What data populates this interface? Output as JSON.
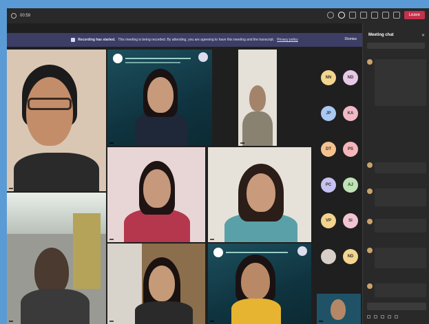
{
  "window": {
    "title": "00:59"
  },
  "toolbar": {
    "leave_label": "Leave"
  },
  "banner": {
    "heading": "Recording has started.",
    "text": "This meeting is being recorded. By attending, you are agreeing to have this meeting and the transcript.",
    "link": "Privacy policy",
    "dismiss_label": "Dismiss"
  },
  "participants": [
    {
      "name": ""
    },
    {
      "name": ""
    },
    {
      "name": ""
    },
    {
      "name": ""
    },
    {
      "name": ""
    },
    {
      "name": ""
    },
    {
      "name": ""
    },
    {
      "name": ""
    },
    {
      "name": ""
    }
  ],
  "roster": [
    {
      "initials": "NN",
      "color": "#f4d58d"
    },
    {
      "initials": "ND",
      "color": "#e7c8e6"
    },
    {
      "initials": "JP",
      "color": "#a9c8f3"
    },
    {
      "initials": "KA",
      "color": "#f1b9c7"
    },
    {
      "initials": "DT",
      "color": "#f5c28f"
    },
    {
      "initials": "PS",
      "color": "#f6b6b9"
    },
    {
      "initials": "PC",
      "color": "#c6c3f1"
    },
    {
      "initials": "AJ",
      "color": "#bfe3b5"
    },
    {
      "initials": "VP",
      "color": "#f3d38d"
    },
    {
      "initials": "SI",
      "color": "#f2c4d2"
    },
    {
      "initials": "",
      "color": "#d8d0c8"
    },
    {
      "initials": "ND",
      "color": "#f3d58f"
    }
  ],
  "chat": {
    "header": "Meeting chat",
    "search_placeholder": "",
    "compose_placeholder": "",
    "messages": [
      {
        "author": "",
        "text": ""
      },
      {
        "author": "",
        "text": ""
      },
      {
        "author": "",
        "text": ""
      },
      {
        "author": "",
        "text": ""
      },
      {
        "author": "",
        "text": ""
      },
      {
        "author": "",
        "text": ""
      }
    ]
  }
}
